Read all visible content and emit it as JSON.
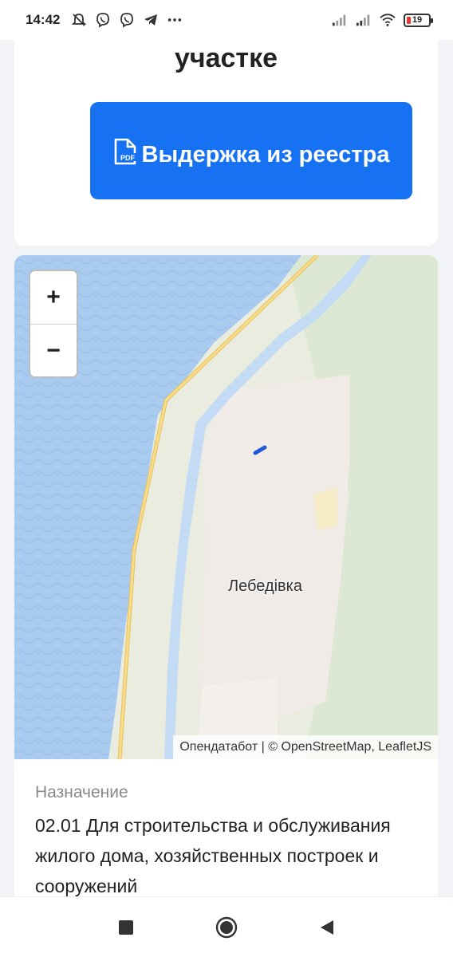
{
  "status_bar": {
    "time": "14:42",
    "battery_level": "19",
    "icons_left": [
      "notifications-off-icon",
      "viber-icon",
      "viber-icon",
      "telegram-icon",
      "more-icon"
    ],
    "icons_right": [
      "signal-icon",
      "signal-icon",
      "wifi-icon",
      "battery-icon"
    ]
  },
  "card_top": {
    "heading_tail": "участке",
    "pdf_button_label": "Выдержка из реестра",
    "pdf_icon": "pdf-file-icon",
    "button_color": "#1672f3"
  },
  "map": {
    "zoom_in_label": "+",
    "zoom_out_label": "−",
    "place_label": "Лебедівка",
    "attribution": "Опендатабот | © OpenStreetMap, LeafletJS",
    "colors": {
      "water": "#aacbf0",
      "land": "#e9ecdf",
      "forest": "#dde8d4",
      "settlement": "#f0ebe7",
      "road": "#f6cf6e"
    }
  },
  "info": {
    "label": "Назначение",
    "value": "02.01 Для строительства и обслуживания жилого дома, хозяйственных построек и сооружений"
  },
  "nav_bar": {
    "icons": [
      "recents-square-icon",
      "home-circle-icon",
      "back-triangle-icon"
    ]
  }
}
